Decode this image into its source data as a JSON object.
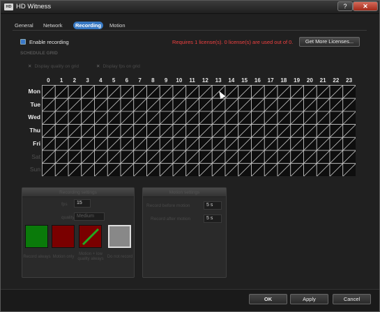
{
  "window": {
    "title": "HD Witness",
    "help_label": "?",
    "close_label": "✕",
    "app_icon": "app-logo-icon",
    "app_icon_text": "HD"
  },
  "tabs": [
    {
      "label": "General",
      "active": false
    },
    {
      "label": "Network",
      "active": false
    },
    {
      "label": "Recording",
      "active": true
    },
    {
      "label": "Motion",
      "active": false
    }
  ],
  "recording": {
    "enable_label": "Enable recording",
    "enabled": true,
    "license_warning": "Requires 1 license(s). 0 license(s) are used out of 0.",
    "more_licenses_label": "Get More Licenses..."
  },
  "schedule": {
    "title": "SCHEDULE GRID",
    "options": [
      {
        "label": "Display quality on grid",
        "checked": false
      },
      {
        "label": "Display fps on grid",
        "checked": false
      }
    ],
    "hours": [
      "0",
      "1",
      "2",
      "3",
      "4",
      "5",
      "6",
      "7",
      "8",
      "9",
      "10",
      "11",
      "12",
      "13",
      "14",
      "15",
      "16",
      "17",
      "18",
      "19",
      "20",
      "21",
      "22",
      "23"
    ],
    "days": [
      {
        "label": "Mon",
        "enabled": true
      },
      {
        "label": "Tue",
        "enabled": true
      },
      {
        "label": "Wed",
        "enabled": true
      },
      {
        "label": "Thu",
        "enabled": true
      },
      {
        "label": "Fri",
        "enabled": true
      },
      {
        "label": "Sat",
        "enabled": false
      },
      {
        "label": "Sun",
        "enabled": false
      }
    ],
    "cell_state": "do-not-record"
  },
  "recording_settings": {
    "title": "Recording settings",
    "fps_label": "fps",
    "fps_value": "15",
    "quality_label": "quality",
    "quality_value": "Medium",
    "modes": [
      {
        "label": "Record always",
        "color": "#0a7a0a"
      },
      {
        "label": "Motion only",
        "color": "#7a0000"
      },
      {
        "label": "Motion + low quality always",
        "color": "#7a0000",
        "accent": "#22aa22"
      },
      {
        "label": "Do not record",
        "color": "#888888"
      }
    ]
  },
  "motion_settings": {
    "title": "Motion settings",
    "before_label": "Record before motion",
    "before_value": "5 s",
    "after_label": "Record after motion",
    "after_value": "5 s"
  },
  "buttons": {
    "ok": "OK",
    "apply": "Apply",
    "cancel": "Cancel"
  },
  "colors": {
    "accent": "#3778c2",
    "warning": "#f04040",
    "grid_line": "#c8c8c8"
  }
}
